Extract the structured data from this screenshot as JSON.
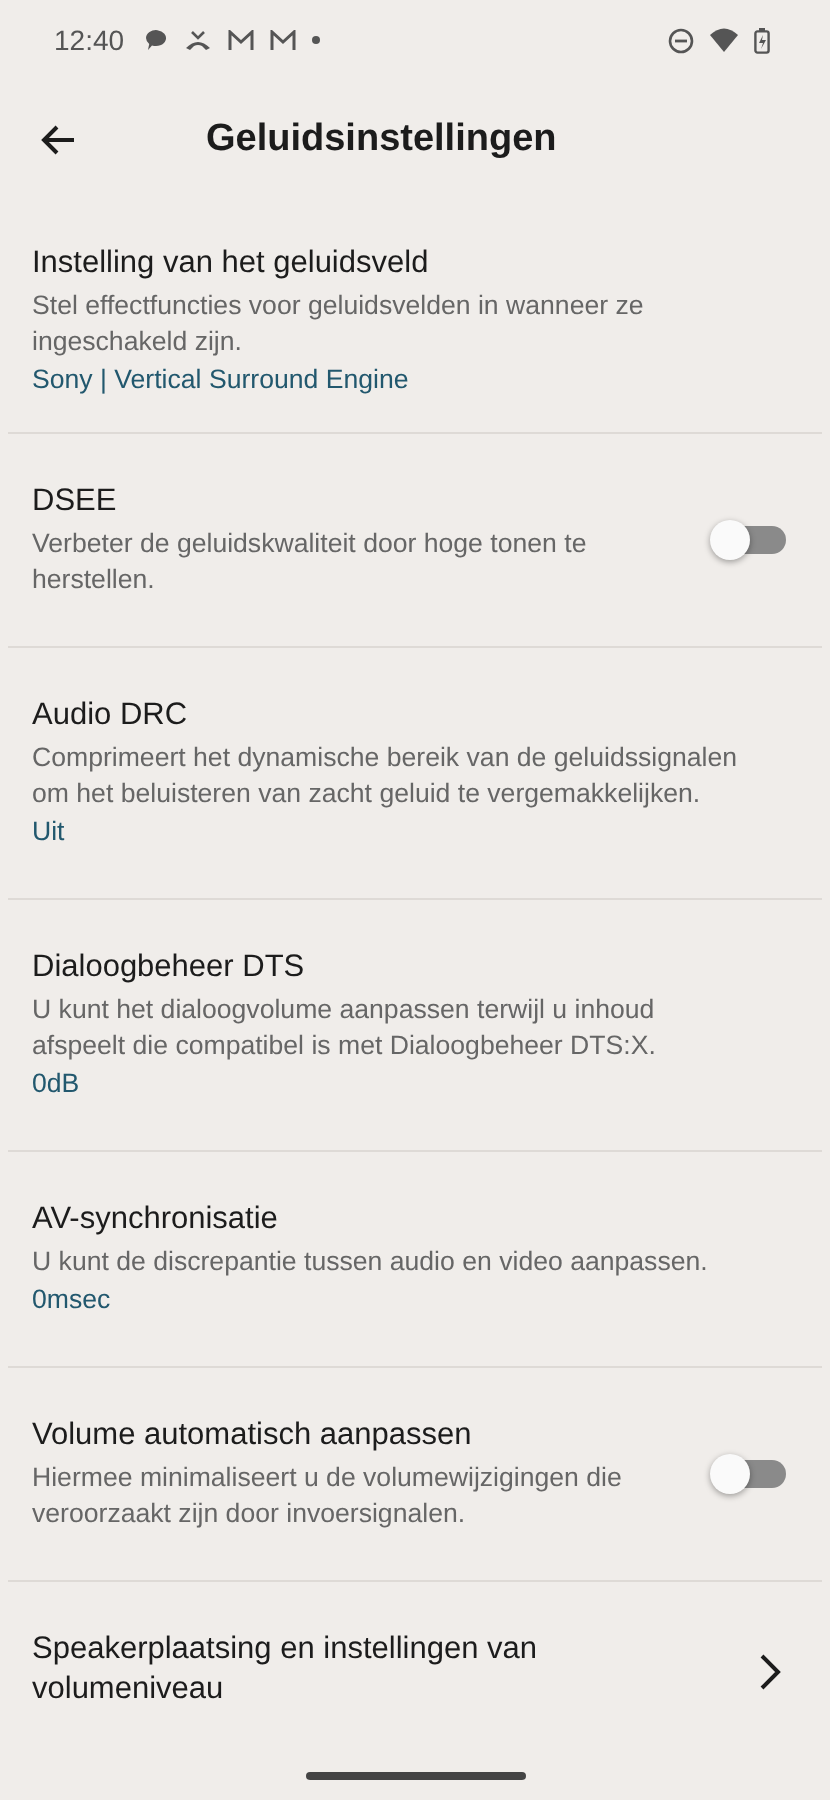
{
  "status_bar": {
    "time": "12:40"
  },
  "header": {
    "title": "Geluidsinstellingen"
  },
  "items": [
    {
      "kind": "value",
      "title": "Instelling van het geluidsveld",
      "description": "Stel effectfuncties voor geluidsvelden in wanneer ze ingeschakeld zijn.",
      "value": "Sony | Vertical Surround Engine"
    },
    {
      "kind": "toggle",
      "title": "DSEE",
      "description": "Verbeter de geluidskwaliteit door hoge tonen te herstellen.",
      "on": false
    },
    {
      "kind": "value",
      "title": "Audio DRC",
      "description": "Comprimeert het dynamische bereik van de geluidssignalen om het beluisteren van zacht geluid te vergemakkelijken.",
      "value": "Uit"
    },
    {
      "kind": "value",
      "title": "Dialoogbeheer DTS",
      "description": "U kunt het dialoogvolume aanpassen terwijl u inhoud afspeelt die compatibel is met Dialoogbeheer DTS:X.",
      "value": "0dB"
    },
    {
      "kind": "value",
      "title": "AV-synchronisatie",
      "description": "U kunt de discrepantie tussen audio en video aanpassen.",
      "value": "0msec"
    },
    {
      "kind": "toggle",
      "title": "Volume automatisch aanpassen",
      "description": "Hiermee minimaliseert u de volumewijzigingen die veroorzaakt zijn door invoersignalen.",
      "on": false
    },
    {
      "kind": "link",
      "title": "Speakerplaatsing en instellingen van volumeniveau"
    }
  ]
}
